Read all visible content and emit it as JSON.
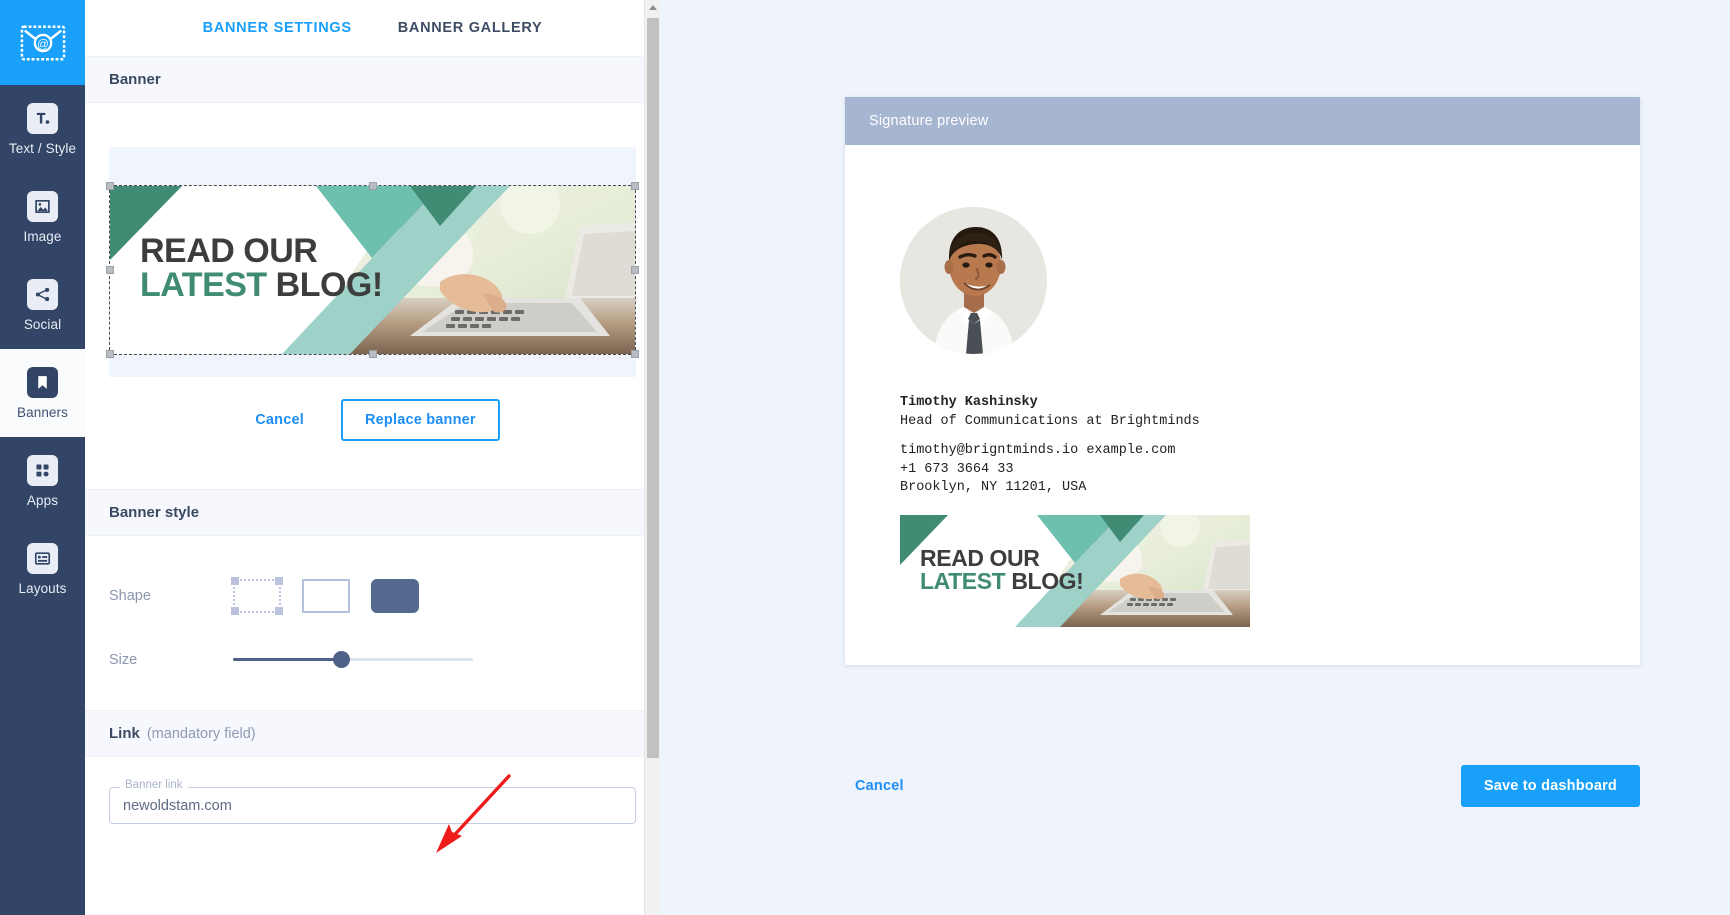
{
  "brand": {
    "accent": "#18a0fb",
    "rail_bg": "#334566",
    "preview_bg": "#eef3fc"
  },
  "sidebar": {
    "logo_name": "email-signature-logo",
    "items": [
      {
        "label": "Text / Style",
        "icon": "text-style-icon",
        "active": false
      },
      {
        "label": "Image",
        "icon": "image-icon",
        "active": false
      },
      {
        "label": "Social",
        "icon": "share-icon",
        "active": false
      },
      {
        "label": "Banners",
        "icon": "bookmark-icon",
        "active": true
      },
      {
        "label": "Apps",
        "icon": "grid-icon",
        "active": false
      },
      {
        "label": "Layouts",
        "icon": "layout-icon",
        "active": false
      }
    ]
  },
  "editor": {
    "tabs": [
      {
        "label": "BANNER SETTINGS",
        "active": true
      },
      {
        "label": "BANNER GALLERY",
        "active": false
      }
    ],
    "banner_section": {
      "title": "Banner",
      "banner_alt": "READ OUR LATEST BLOG!",
      "banner_headline_line1": "READ OUR",
      "banner_headline_accent": "LATEST",
      "banner_headline_line2": "BLOG!",
      "cancel_label": "Cancel",
      "replace_label": "Replace banner"
    },
    "style_section": {
      "title": "Banner style",
      "shape_label": "Shape",
      "shape_options": [
        {
          "name": "shape-option-dashed",
          "selected": false
        },
        {
          "name": "shape-option-square",
          "selected": false
        },
        {
          "name": "shape-option-rounded",
          "selected": true
        }
      ],
      "size_label": "Size",
      "size_value": 45
    },
    "link_section": {
      "title": "Link",
      "title_note": "(mandatory field)",
      "field_legend": "Banner link",
      "field_value": "newoldstam.com",
      "field_placeholder": "Banner link"
    },
    "scrollbar": {
      "name": "editor-vertical-scrollbar"
    }
  },
  "preview": {
    "header_title": "Signature preview",
    "signature": {
      "avatar_alt": "Profile photo of Timothy Kashinsky",
      "name": "Timothy Kashinsky",
      "title": "Head of Communications at Brightminds",
      "email_line": "timothy@brigntminds.io example.com",
      "phone": "+1 673 3664 33",
      "address": "Brooklyn, NY 11201, USA",
      "banner_alt": "READ OUR LATEST BLOG!",
      "banner_headline_line1": "READ OUR",
      "banner_headline_accent": "LATEST",
      "banner_headline_line2": "BLOG!"
    },
    "actions": {
      "cancel_label": "Cancel",
      "save_label": "Save to dashboard"
    }
  },
  "annotation": {
    "arrow_color": "#ee1b1b",
    "name": "red-pointer-arrow"
  }
}
